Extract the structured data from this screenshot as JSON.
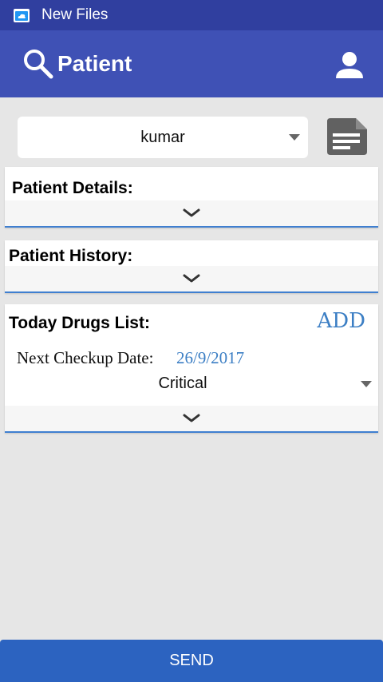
{
  "status_bar": {
    "app_name": "New Files",
    "icon": "cloud-folder-icon"
  },
  "app_bar": {
    "title": "Patient",
    "search_icon": "search-icon",
    "profile_icon": "person-icon"
  },
  "patient_selector": {
    "selected": "kumar",
    "icon": "dropdown-arrow-icon"
  },
  "document_button": {
    "icon": "document-icon"
  },
  "sections": {
    "details": {
      "title": "Patient Details:",
      "icon": "chevron-down-icon"
    },
    "history": {
      "title": "Patient History:",
      "icon": "chevron-down-icon"
    },
    "drugs": {
      "title": "Today Drugs List:",
      "add_label": "ADD",
      "next_checkup_label": "Next Checkup Date:",
      "next_checkup_date": "26/9/2017",
      "priority": "Critical",
      "icon": "chevron-down-icon"
    }
  },
  "send_button": {
    "label": "SEND"
  },
  "colors": {
    "status_bar": "#303f9f",
    "app_bar": "#3f51b5",
    "accent": "#3b7ec4",
    "send_button": "#2c63c0",
    "background": "#e6e6e6"
  }
}
